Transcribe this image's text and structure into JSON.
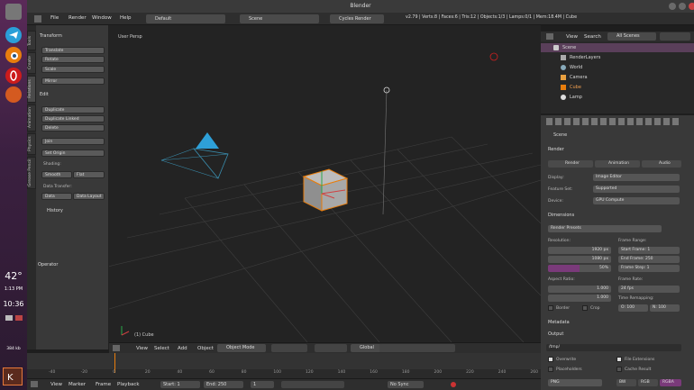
{
  "window": {
    "title": "Blender"
  },
  "dock": {
    "temp": "42°",
    "date": "1:13 PM",
    "time": "10:36",
    "net": "384 kb"
  },
  "menubar": {
    "items": [
      "File",
      "Render",
      "Window",
      "Help"
    ],
    "layout": "Default",
    "scene": "Scene",
    "engine": "Cycles Render",
    "stats": "v2.79 | Verts:8 | Faces:6 | Tris:12 | Objects:1/3 | Lamps:0/1 | Mem:18.4M | Cube"
  },
  "left_tabs": [
    "Tools",
    "Create",
    "Relations",
    "Animation",
    "Physics",
    "Grease Pencil"
  ],
  "shelf": {
    "transform_header": "Transform",
    "transform_buttons": [
      "Translate",
      "Rotate",
      "Scale",
      "Mirror"
    ],
    "edit_header": "Edit",
    "edit_buttons": [
      "Duplicate",
      "Duplicate Linked",
      "Delete",
      "Join"
    ],
    "set_origin": "Set Origin",
    "shading_label": "Shading:",
    "smooth": "Smooth",
    "flat": "Flat",
    "data_transfer_label": "Data Transfer:",
    "data": "Data",
    "data_layout": "Data Layout",
    "history_header": "History",
    "operator_header": "Operator"
  },
  "viewport": {
    "label": "User Persp",
    "object_label": "(1) Cube"
  },
  "vp_header": {
    "view": "View",
    "select": "Select",
    "add": "Add",
    "object": "Object",
    "mode": "Object Mode",
    "pivot": "Global"
  },
  "timeline": {
    "ticks": [
      "-40",
      "-20",
      "0",
      "20",
      "40",
      "60",
      "80",
      "100",
      "120",
      "140",
      "160",
      "180",
      "200",
      "220",
      "240",
      "260"
    ]
  },
  "tl_bar": {
    "view": "View",
    "marker": "Marker",
    "frame": "Frame",
    "playback": "Playback",
    "start": "Start:",
    "start_val": "1",
    "end": "End:",
    "end_val": "250",
    "current": "1",
    "sync": "No Sync"
  },
  "outliner": {
    "view": "View",
    "search": "Search",
    "filter": "All Scenes",
    "rows": [
      {
        "name": "Scene"
      },
      {
        "name": "RenderLayers"
      },
      {
        "name": "World"
      },
      {
        "name": "Camera"
      },
      {
        "name": "Cube"
      },
      {
        "name": "Lamp"
      }
    ]
  },
  "props": {
    "scene": "Scene",
    "render_header": "Render",
    "render_btn": "Render",
    "animation_btn": "Animation",
    "audio_btn": "Audio",
    "display_label": "Display:",
    "display_val": "Image Editor",
    "feature_label": "Feature Set:",
    "feature_val": "Supported",
    "device_label": "Device:",
    "device_val": "GPU Compute",
    "dimensions_header": "Dimensions",
    "presets": "Render Presets",
    "resolution_label": "Resolution:",
    "res_x": "1920 px",
    "res_y": "1080 px",
    "res_pct": "50%",
    "frame_range_label": "Frame Range:",
    "start_frame": "Start Frame: 1",
    "end_frame": "End Frame: 250",
    "frame_step": "Frame Step: 1",
    "aspect_label": "Aspect Ratio:",
    "aspect_x": "1.000",
    "aspect_y": "1.000",
    "frame_rate_label": "Frame Rate:",
    "frame_rate": "24 fps",
    "time_remap_label": "Time Remapping:",
    "remap_old": "O: 100",
    "remap_new": "N: 100",
    "border": "Border",
    "crop": "Crop",
    "metadata_header": "Metadata",
    "output_header": "Output",
    "output_path": "/tmp/",
    "overwrite": "Overwrite",
    "file_ext": "File Extensions",
    "placeholders": "Placeholders",
    "cache_result": "Cache Result",
    "format": "PNG",
    "bw": "BW",
    "rgb": "RGB",
    "rgba": "RGBA"
  }
}
